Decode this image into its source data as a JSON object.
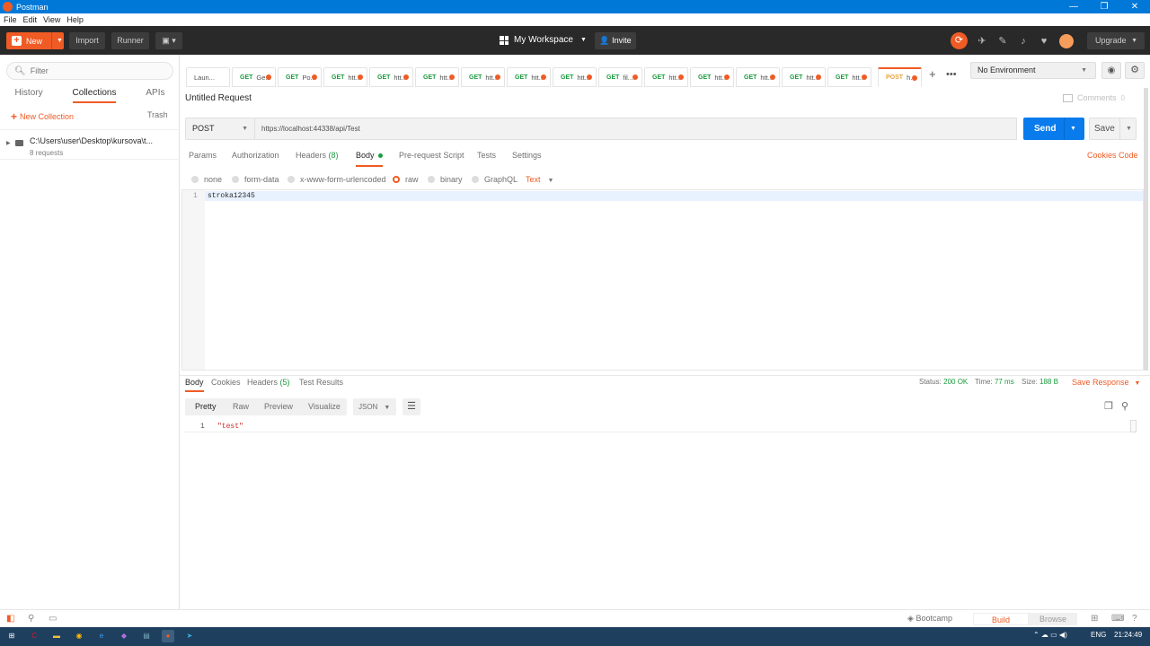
{
  "window": {
    "title": "Postman",
    "controls": [
      "—",
      "❐",
      "✕"
    ]
  },
  "menubar": [
    "File",
    "Edit",
    "View",
    "Help"
  ],
  "header": {
    "new_label": "New",
    "import_label": "Import",
    "runner_label": "Runner",
    "workspace_label": "My Workspace",
    "invite_label": "Invite",
    "upgrade_label": "Upgrade"
  },
  "sidebar": {
    "filter_placeholder": "Filter",
    "tabs": [
      "History",
      "Collections",
      "APIs"
    ],
    "active_tab": "Collections",
    "new_collection_label": "New Collection",
    "trash_label": "Trash",
    "collection": {
      "name": "C:\\Users\\user\\Desktop\\kursova\\t...",
      "count": "8 requests"
    }
  },
  "request_tabs": [
    {
      "method": "",
      "label": "Laun..."
    },
    {
      "method": "GET",
      "label": "Ge..."
    },
    {
      "method": "GET",
      "label": "Po..."
    },
    {
      "method": "GET",
      "label": "htt..."
    },
    {
      "method": "GET",
      "label": "htt..."
    },
    {
      "method": "GET",
      "label": "htt..."
    },
    {
      "method": "GET",
      "label": "htt..."
    },
    {
      "method": "GET",
      "label": "htt..."
    },
    {
      "method": "GET",
      "label": "htt..."
    },
    {
      "method": "GET",
      "label": "fil..."
    },
    {
      "method": "GET",
      "label": "htt..."
    },
    {
      "method": "GET",
      "label": "htt..."
    },
    {
      "method": "GET",
      "label": "htt..."
    },
    {
      "method": "GET",
      "label": "htt..."
    },
    {
      "method": "GET",
      "label": "htt..."
    },
    {
      "method": "POST",
      "label": "h..."
    }
  ],
  "environment": {
    "selected": "No Environment"
  },
  "request": {
    "title": "Untitled Request",
    "comments_label": "Comments",
    "comments_count": "0",
    "method": "POST",
    "url": "https://localhost:44338/api/Test",
    "send_label": "Send",
    "save_label": "Save"
  },
  "param_tabs": {
    "params": "Params",
    "authorization": "Authorization",
    "headers": "Headers",
    "headers_count": "(8)",
    "body": "Body",
    "prerequest": "Pre-request Script",
    "tests": "Tests",
    "settings": "Settings",
    "cookies": "Cookies",
    "code": "Code"
  },
  "body_types": {
    "none": "none",
    "form_data": "form-data",
    "urlencoded": "x-www-form-urlencoded",
    "raw": "raw",
    "binary": "binary",
    "graphql": "GraphQL",
    "text_type": "Text",
    "selected": "raw"
  },
  "editor": {
    "line_number": "1",
    "content": "stroka12345"
  },
  "response": {
    "tabs": {
      "body": "Body",
      "cookies": "Cookies",
      "headers": "Headers",
      "headers_count": "(5)",
      "test_results": "Test Results"
    },
    "status_label": "Status:",
    "status_value": "200 OK",
    "time_label": "Time:",
    "time_value": "77 ms",
    "size_label": "Size:",
    "size_value": "188 B",
    "save_response_label": "Save Response",
    "view_tabs": [
      "Pretty",
      "Raw",
      "Preview",
      "Visualize"
    ],
    "format": "JSON",
    "line_number": "1",
    "content": "\"test\""
  },
  "statusbar": {
    "bootcamp": "Bootcamp",
    "build": "Build",
    "browse": "Browse"
  },
  "taskbar": {
    "language": "ENG",
    "time": "21:24:49"
  },
  "colors": {
    "accent": "#ef5b25",
    "send": "#097bed",
    "get": "#1b9b3e",
    "post": "#e8a33d",
    "titlebar": "#0078d7"
  }
}
